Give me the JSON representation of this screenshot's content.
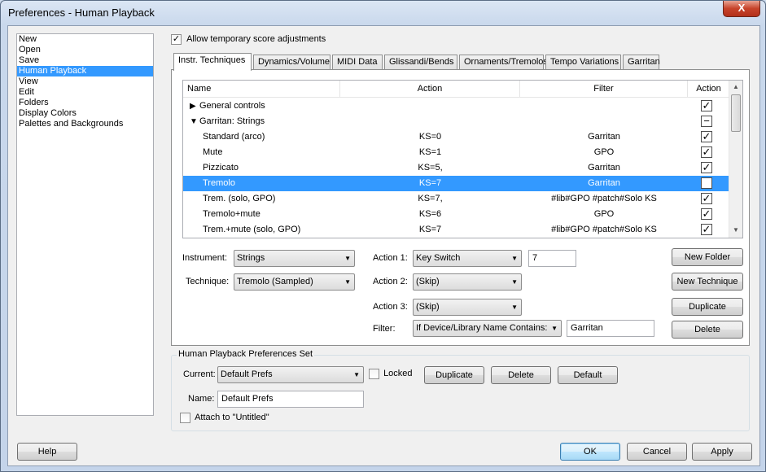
{
  "window": {
    "title": "Preferences - Human Playback",
    "close_glyph": "X"
  },
  "categories": [
    {
      "label": "New"
    },
    {
      "label": "Open"
    },
    {
      "label": "Save"
    },
    {
      "label": "Human Playback"
    },
    {
      "label": "View"
    },
    {
      "label": "Edit"
    },
    {
      "label": "Folders"
    },
    {
      "label": "Display Colors"
    },
    {
      "label": "Palettes and Backgrounds"
    }
  ],
  "selected_category": "Human Playback",
  "allow_adjustments": {
    "label": "Allow temporary score adjustments",
    "checked": true
  },
  "tabs": [
    {
      "label": "Instr. Techniques"
    },
    {
      "label": "Dynamics/Volume"
    },
    {
      "label": "MIDI Data"
    },
    {
      "label": "Glissandi/Bends"
    },
    {
      "label": "Ornaments/Tremolos"
    },
    {
      "label": "Tempo Variations"
    },
    {
      "label": "Garritan"
    }
  ],
  "active_tab": "Instr. Techniques",
  "table": {
    "headers": {
      "name": "Name",
      "action": "Action",
      "filter": "Filter",
      "action2": "Action"
    },
    "rows": [
      {
        "name": "General controls",
        "action": "",
        "filter": "",
        "check": "checked",
        "expander": "▶",
        "level": 0,
        "selected": false
      },
      {
        "name": "Garritan: Strings",
        "action": "",
        "filter": "",
        "check": "partial",
        "expander": "▼",
        "level": 0,
        "selected": false
      },
      {
        "name": "Standard (arco)",
        "action": "KS=0",
        "filter": "Garritan",
        "check": "checked",
        "expander": "",
        "level": 1,
        "selected": false
      },
      {
        "name": "Mute",
        "action": "KS=1",
        "filter": "GPO",
        "check": "checked",
        "expander": "",
        "level": 1,
        "selected": false
      },
      {
        "name": "Pizzicato",
        "action": "KS=5,",
        "filter": "Garritan",
        "check": "checked",
        "expander": "",
        "level": 1,
        "selected": false
      },
      {
        "name": "Tremolo",
        "action": "KS=7",
        "filter": "Garritan",
        "check": "unchecked",
        "expander": "",
        "level": 1,
        "selected": true
      },
      {
        "name": "Trem. (solo, GPO)",
        "action": "KS=7,",
        "filter": "#lib#GPO #patch#Solo KS",
        "check": "checked",
        "expander": "",
        "level": 1,
        "selected": false
      },
      {
        "name": "Tremolo+mute",
        "action": "KS=6",
        "filter": "GPO",
        "check": "checked",
        "expander": "",
        "level": 1,
        "selected": false
      },
      {
        "name": "Trem.+mute (solo, GPO)",
        "action": "KS=7",
        "filter": "#lib#GPO #patch#Solo KS",
        "check": "checked",
        "expander": "",
        "level": 1,
        "selected": false
      }
    ]
  },
  "form": {
    "instrument_label": "Instrument:",
    "instrument_value": "Strings",
    "technique_label": "Technique:",
    "technique_value": "Tremolo (Sampled)",
    "action1_label": "Action 1:",
    "action1_value": "Key Switch",
    "action1_text": "7",
    "action2_label": "Action 2:",
    "action2_value": "(Skip)",
    "action3_label": "Action 3:",
    "action3_value": "(Skip)",
    "filter_label": "Filter:",
    "filter_value": "If Device/Library Name Contains:",
    "filter_text": "Garritan",
    "new_folder": "New Folder",
    "new_technique": "New Technique",
    "duplicate": "Duplicate",
    "delete": "Delete"
  },
  "prefs_set": {
    "title": "Human Playback Preferences Set",
    "current_label": "Current:",
    "current_value": "Default Prefs",
    "locked_label": "Locked",
    "locked_checked": false,
    "duplicate": "Duplicate",
    "delete": "Delete",
    "default": "Default",
    "name_label": "Name:",
    "name_value": "Default Prefs",
    "attach_label": "Attach to \"Untitled\"",
    "attach_checked": false
  },
  "footer": {
    "help": "Help",
    "ok": "OK",
    "cancel": "Cancel",
    "apply": "Apply"
  },
  "colors": {
    "selection": "#3399ff",
    "window_frame": "#c4d4ea"
  }
}
